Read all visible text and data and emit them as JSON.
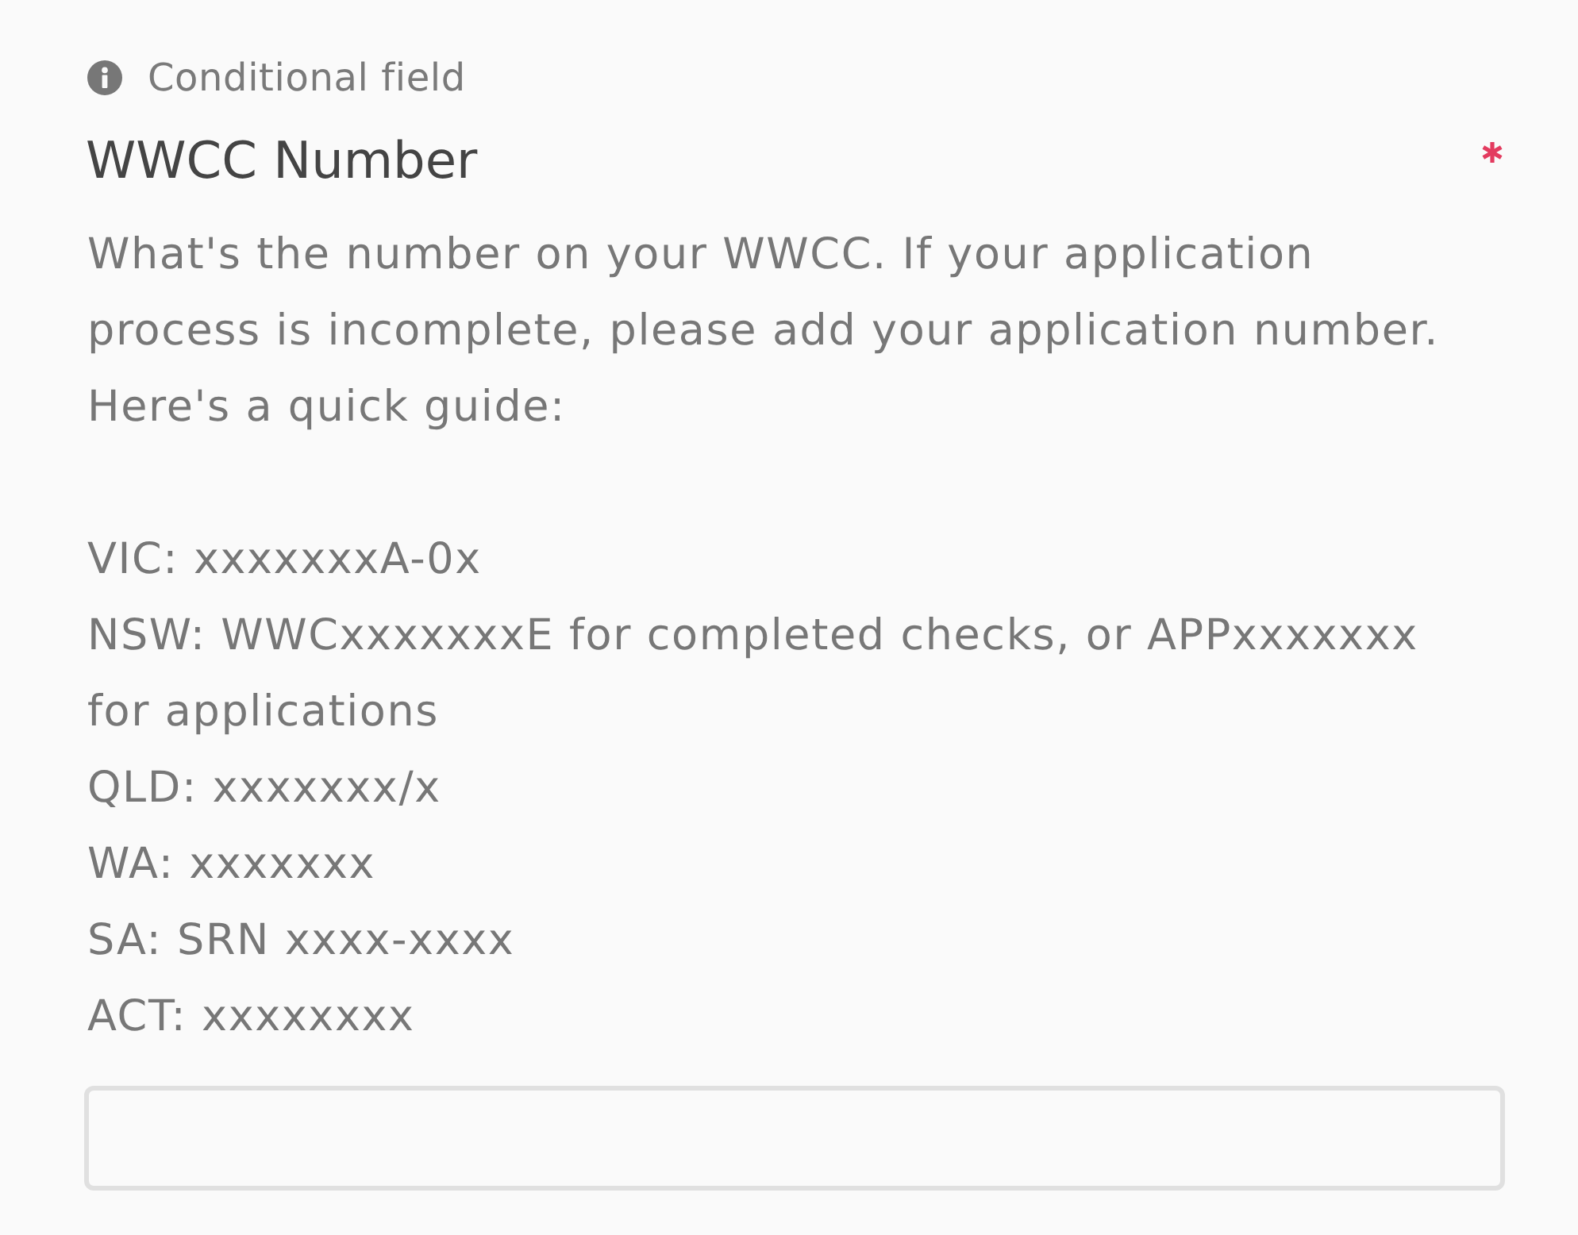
{
  "conditional_note": {
    "label": "Conditional field"
  },
  "field": {
    "label": "WWCC Number",
    "required": true,
    "description": "What's the number on your WWCC. If your application process is incomplete, please add your application number. Here's a quick guide:",
    "guide": [
      "VIC: xxxxxxxA-0x",
      "NSW: WWCxxxxxxxE for completed checks, or APPxxxxxxx for applications",
      "QLD: xxxxxxx/x",
      "WA: xxxxxxx",
      "SA: SRN xxxx-xxxx",
      "ACT: xxxxxxxx"
    ]
  }
}
